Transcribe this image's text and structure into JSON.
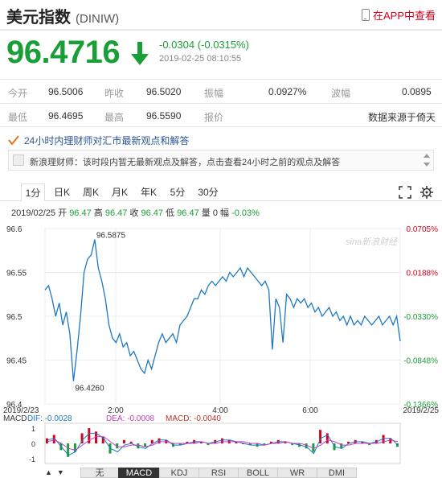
{
  "header": {
    "title": "美元指数",
    "symbol": "(DINIW)",
    "app_link": "在APP中查看"
  },
  "quote": {
    "price": "96.4716",
    "change": "-0.0304 (-0.0315%)",
    "timestamp": "2019-02-25  08:10:55",
    "direction": "down",
    "color_down": "#1a9e37"
  },
  "stats": [
    [
      {
        "label": "今开",
        "value": "96.5006"
      },
      {
        "label": "昨收",
        "value": "96.5020"
      },
      {
        "label": "振幅",
        "value": "0.0927%"
      },
      {
        "label": "波幅",
        "value": "0.0895"
      }
    ],
    [
      {
        "label": "最低",
        "value": "96.4695"
      },
      {
        "label": "最高",
        "value": "96.5590"
      },
      {
        "label": "报价",
        "value": ""
      },
      {
        "label": "",
        "value": "数据来源于倚天"
      }
    ]
  ],
  "notice": {
    "headline": "24小时内理财师对汇市最新观点和解答",
    "news_text": "新浪理财师：该时段内暂无最新观点及解答，点击查看24小时之前的观点及解答"
  },
  "tabs": [
    "1分",
    "日K",
    "周K",
    "月K",
    "年K",
    "5分",
    "30分"
  ],
  "active_tab": "1分",
  "ohlc": {
    "date": "2019/02/25",
    "open_label": "开",
    "open": "96.47",
    "high_label": "高",
    "high": "96.47",
    "close_label": "收",
    "close": "96.47",
    "low_label": "低",
    "low": "96.47",
    "vol_label": "量",
    "vol": "0",
    "amp_label": "幅",
    "amp": "-0.03%"
  },
  "chart_data": {
    "type": "line",
    "title": "",
    "xlabel": "",
    "ylabel": "",
    "ylim": [
      96.4,
      96.6
    ],
    "y_ticks": [
      "96.6",
      "96.55",
      "96.5",
      "96.45",
      "96.4"
    ],
    "y_ticks_right": [
      "0.0705%",
      "0.0188%",
      "-0.0330%",
      "-0.0848%",
      "-0.1366%"
    ],
    "x_ticks": [
      "2019/2/23",
      "2:00",
      "4:00",
      "6:00",
      "2019/2/25"
    ],
    "annotations": [
      {
        "text": "96.5875"
      },
      {
        "text": "96.4260"
      }
    ],
    "watermark": "sina新浪财经",
    "line_color": "#1f78c1",
    "series": [
      {
        "x": [
          0,
          3,
          6,
          9,
          12,
          15,
          18,
          21,
          24,
          27,
          30,
          33,
          36,
          39,
          42,
          45,
          48,
          51,
          54,
          57,
          60,
          63,
          66,
          69,
          72,
          75,
          78,
          81,
          84,
          87,
          90,
          93,
          96,
          99,
          102,
          105,
          108,
          111,
          114,
          117,
          120,
          123,
          126,
          129,
          132,
          135,
          138,
          141,
          144,
          147,
          150,
          153,
          156,
          159,
          162,
          165,
          168,
          171,
          174,
          177,
          180,
          183,
          186,
          189,
          192,
          195,
          198,
          201,
          204,
          207,
          210,
          213,
          216,
          219,
          222,
          225,
          228,
          231,
          234,
          237,
          240,
          243,
          246,
          249,
          252,
          255,
          258,
          261,
          264,
          267,
          270,
          273,
          276,
          279,
          282,
          285,
          288,
          291,
          294,
          297,
          300
        ],
        "values": [
          96.53,
          96.535,
          96.52,
          96.5,
          96.515,
          96.49,
          96.505,
          96.48,
          96.426,
          96.46,
          96.5,
          96.55,
          96.565,
          96.57,
          96.5875,
          96.555,
          96.54,
          96.52,
          96.49,
          96.475,
          96.47,
          96.48,
          96.465,
          96.47,
          96.455,
          96.46,
          96.45,
          96.44,
          96.435,
          96.45,
          96.44,
          96.455,
          96.47,
          96.48,
          96.47,
          96.475,
          96.48,
          96.47,
          96.49,
          96.495,
          96.5,
          96.51,
          96.52,
          96.52,
          96.53,
          96.525,
          96.535,
          96.54,
          96.535,
          96.54,
          96.545,
          96.54,
          96.55,
          96.545,
          96.55,
          96.555,
          96.545,
          96.555,
          96.55,
          96.545,
          96.54,
          96.535,
          96.54,
          96.53,
          96.462,
          96.52,
          96.51,
          96.47,
          96.525,
          96.52,
          96.51,
          96.52,
          96.515,
          96.52,
          96.51,
          96.515,
          96.505,
          96.51,
          96.5,
          96.505,
          96.51,
          96.5,
          96.505,
          96.495,
          96.5,
          96.49,
          96.5,
          96.49,
          96.495,
          96.49,
          96.5,
          96.495,
          96.49,
          96.495,
          96.5,
          96.49,
          96.495,
          96.5,
          96.49,
          96.5,
          96.4716
        ]
      }
    ]
  },
  "macd": {
    "label": "MACD",
    "dif_label": "DIF: -0.0028",
    "dea_label": "DEA: -0.0008",
    "macd_label": "MACD: -0.0040",
    "y_ticks": [
      "1",
      "0",
      "-1"
    ],
    "dif_color": "#1f78c1",
    "dea_color": "#c040c0",
    "macd_color": "#c0302a",
    "hist": [
      0.3,
      0.5,
      -0.4,
      -0.8,
      -0.5,
      0.6,
      0.9,
      0.7,
      0.4,
      -0.6,
      -0.3,
      0.2,
      0.1,
      -0.3,
      -0.2,
      0.2,
      0.3,
      0.2,
      -0.2,
      -0.1,
      0.1,
      0.2,
      0.1,
      -0.1,
      0.2,
      0.3,
      0.2,
      0.1,
      0.0,
      -0.1,
      -0.2,
      -0.1,
      0.1,
      0.2,
      0.1,
      -0.1,
      -0.2,
      -0.3,
      -0.5,
      0.8,
      0.6,
      -0.4,
      -0.3,
      0.1,
      0.2,
      0.1,
      -0.1,
      0.2,
      0.5,
      0.3,
      -0.2
    ],
    "dif": [
      0.2,
      0.3,
      -0.2,
      -0.7,
      -0.5,
      0.2,
      0.6,
      0.6,
      0.3,
      -0.3,
      -0.5,
      -0.1,
      0.0,
      -0.2,
      -0.3,
      0.0,
      0.2,
      0.2,
      -0.1,
      -0.1,
      0.0,
      0.1,
      0.1,
      0.0,
      0.1,
      0.2,
      0.2,
      0.1,
      0.0,
      -0.1,
      -0.1,
      -0.1,
      0.0,
      0.1,
      0.1,
      0.0,
      -0.1,
      -0.2,
      -0.6,
      0.3,
      0.5,
      -0.2,
      -0.3,
      0.0,
      0.1,
      0.1,
      0.0,
      0.1,
      0.3,
      0.3,
      -0.1
    ],
    "dea": [
      0.1,
      0.2,
      0.0,
      -0.3,
      -0.4,
      -0.1,
      0.2,
      0.4,
      0.4,
      0.1,
      -0.2,
      -0.2,
      -0.1,
      -0.1,
      -0.2,
      -0.1,
      0.1,
      0.1,
      0.0,
      0.0,
      0.0,
      0.0,
      0.1,
      0.0,
      0.0,
      0.1,
      0.1,
      0.1,
      0.1,
      0.0,
      0.0,
      -0.1,
      0.0,
      0.0,
      0.1,
      0.0,
      0.0,
      -0.1,
      -0.3,
      -0.1,
      0.2,
      0.1,
      -0.1,
      -0.1,
      0.0,
      0.0,
      0.0,
      0.0,
      0.1,
      0.2,
      0.1
    ]
  },
  "indicators": [
    "无",
    "MACD",
    "KDJ",
    "RSI",
    "BOLL",
    "WR",
    "DMI"
  ],
  "active_indicator": "MACD"
}
